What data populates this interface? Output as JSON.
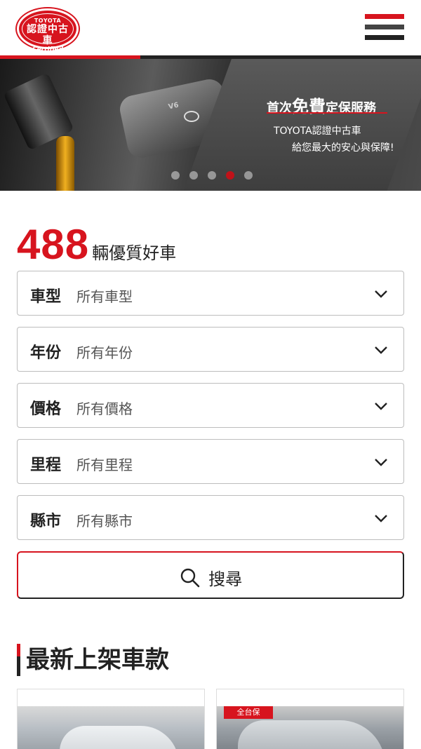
{
  "header": {
    "logo": {
      "brand": "TOYOTA",
      "main": "認證中古車",
      "sub": "Certified"
    },
    "menu_icon": "hamburger-menu-icon",
    "accent_color": "#d7141e"
  },
  "banner": {
    "headline_prefix": "首次",
    "headline_emphasis": "免費",
    "headline_suffix": "定保服務",
    "line1": "TOYOTA認證中古車",
    "line2": "給您最大的安心與保障!",
    "engine_badge": "V6",
    "slide_count": 5,
    "active_slide": 4
  },
  "summary": {
    "count": "488",
    "label": "輛優質好車"
  },
  "filters": [
    {
      "label": "車型",
      "value": "所有車型"
    },
    {
      "label": "年份",
      "value": "所有年份"
    },
    {
      "label": "價格",
      "value": "所有價格"
    },
    {
      "label": "里程",
      "value": "所有里程"
    },
    {
      "label": "縣市",
      "value": "所有縣市"
    }
  ],
  "search": {
    "label": "搜尋",
    "icon": "search-icon"
  },
  "section": {
    "title": "最新上架車款"
  },
  "cards": [
    {
      "image": "car-photo"
    },
    {
      "image": "car-photo",
      "sign_text": "全台保"
    }
  ]
}
